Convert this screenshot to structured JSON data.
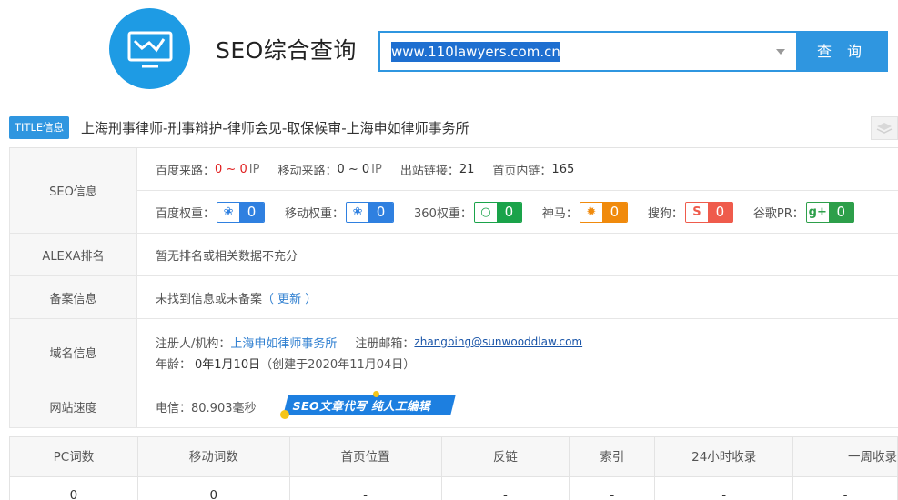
{
  "header": {
    "app_title": "SEO综合查询",
    "search_value": "www.110lawyers.com.cn",
    "search_button": "查 询"
  },
  "title_row": {
    "tag": "TITLE信息",
    "text": "上海刑事律师-刑事辩护-律师会见-取保候审-上海申如律师事务所"
  },
  "seo": {
    "label": "SEO信息",
    "baidu_traffic_label": "百度来路：",
    "baidu_traffic_from": "0",
    "baidu_traffic_sep": " ~ ",
    "baidu_traffic_to": "0",
    "baidu_traffic_unit": "IP",
    "mobile_traffic_label": "移动来路：",
    "mobile_traffic_value": "0 ~ 0",
    "mobile_traffic_unit": "IP",
    "outbound_label": "出站链接：",
    "outbound_value": "21",
    "homepage_links_label": "首页内链：",
    "homepage_links_value": "165",
    "weights": [
      {
        "label": "百度权重：",
        "value": "0",
        "icon": "baidu-paw-icon",
        "color": "#2f80e0"
      },
      {
        "label": "移动权重：",
        "value": "0",
        "icon": "mobile-paw-icon",
        "color": "#2f80e0"
      },
      {
        "label": "360权重：",
        "value": "0",
        "icon": "360-icon",
        "color": "#1aa34a"
      },
      {
        "label": "神马：",
        "value": "0",
        "icon": "shenma-icon",
        "color": "#f08a0c"
      },
      {
        "label": "搜狗：",
        "value": "0",
        "icon": "sogou-icon",
        "color": "#ef5b4c"
      },
      {
        "label": "谷歌PR：",
        "value": "0",
        "icon": "google-plus-icon",
        "color": "#2d9f4a"
      }
    ]
  },
  "alexa": {
    "label": "ALEXA排名",
    "text": "暂无排名或相关数据不充分"
  },
  "icp": {
    "label": "备案信息",
    "text": "未找到信息或未备案",
    "update_link": "（ 更新 ）"
  },
  "domain": {
    "label": "域名信息",
    "registrant_label": "注册人/机构：",
    "registrant_value": "上海申如律师事务所",
    "email_label": "注册邮箱：",
    "email_value": "zhangbing@sunwooddlaw.com",
    "age_label": "年龄：",
    "age_value": "0年1月10日",
    "created": "（创建于2020年11月04日）"
  },
  "speed": {
    "label": "网站速度",
    "text": "电信：80.903毫秒",
    "promo": "SEO文章代写  纯人工编辑"
  },
  "stats": {
    "headers": [
      "PC词数",
      "移动词数",
      "首页位置",
      "反链",
      "索引",
      "24小时收录",
      "一周收录"
    ],
    "values": [
      "0",
      "0",
      "-",
      "-",
      "-",
      "-",
      "-"
    ]
  }
}
